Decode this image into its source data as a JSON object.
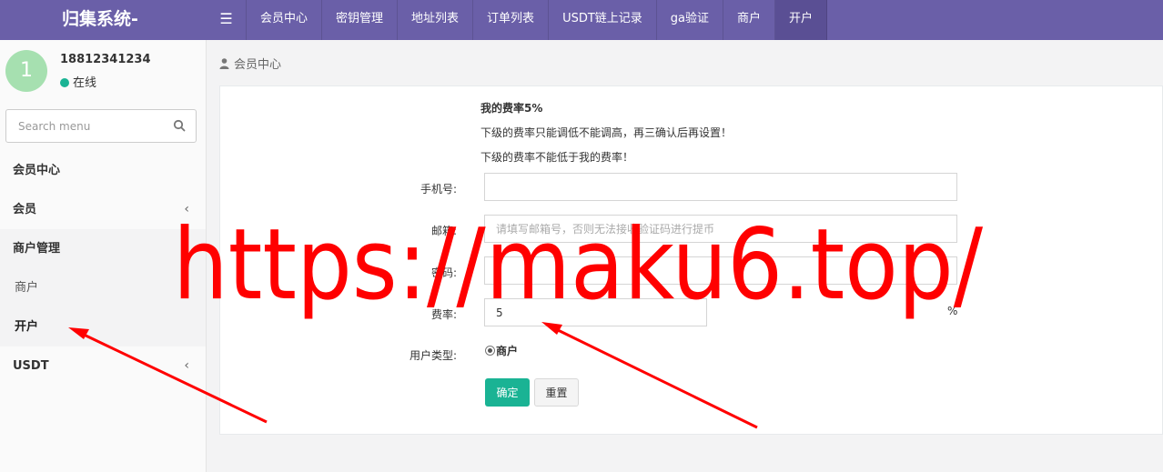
{
  "header": {
    "brand": "归集系统-",
    "nav_items": [
      "会员中心",
      "密钥管理",
      "地址列表",
      "订单列表",
      "USDT链上记录",
      "ga验证",
      "商户",
      "开户"
    ]
  },
  "sidebar": {
    "avatar_letter": "1",
    "user_phone": "18812341234",
    "user_status": "在线",
    "search_placeholder": "Search menu",
    "menu": [
      {
        "label": "会员中心"
      },
      {
        "label": "会员",
        "chevron": "‹"
      },
      {
        "label": "商户管理"
      },
      {
        "label": "商户"
      },
      {
        "label": "开户"
      },
      {
        "label": "USDT",
        "chevron": "‹"
      }
    ]
  },
  "main": {
    "breadcrumb": "会员中心",
    "notes": [
      "我的费率5%",
      "下级的费率只能调低不能调高，再三确认后再设置！",
      "下级的费率不能低于我的费率！"
    ],
    "form": {
      "phone_label": "手机号:",
      "phone_value": "",
      "email_label": "邮箱:",
      "email_placeholder": "请填写邮箱号，否则无法接收验证码进行提币",
      "password_label": "密码:",
      "password_value": "",
      "rate_label": "费率:",
      "rate_value": "5",
      "rate_unit": "%",
      "user_type_label": "用户类型:",
      "user_type_option": "商户",
      "confirm_label": "确定",
      "reset_label": "重置"
    }
  },
  "watermark": {
    "text": "https://maku6.top/",
    "color": "#ff0000"
  },
  "colors": {
    "topbar": "#6a5fa8",
    "accent": "#1ab394",
    "avatar": "#a6e0b0"
  }
}
